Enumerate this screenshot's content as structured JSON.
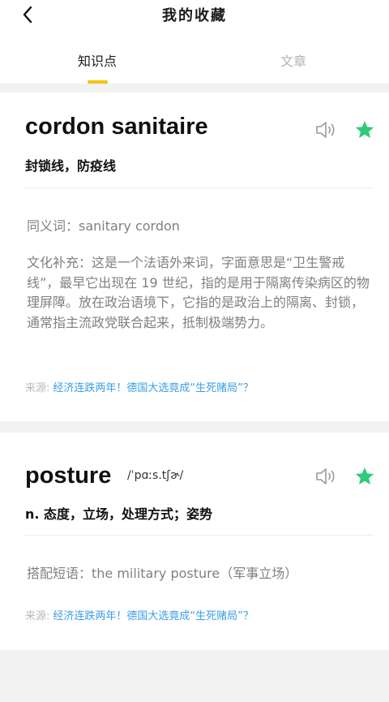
{
  "header": {
    "title": "我的收藏",
    "tabs": [
      {
        "label": "知识点",
        "active": true
      },
      {
        "label": "文章",
        "active": false
      }
    ]
  },
  "cards": [
    {
      "word": "cordon sanitaire",
      "meaning": "封锁线，防疫线",
      "synonym": "同义词：sanitary cordon",
      "culture": "文化补充：这是一个法语外来词，字面意思是“卫生警戒线”，最早它出现在 19 世纪，指的是用于隔离传染病区的物理屏障。放在政治语境下，它指的是政治上的隔离、封锁，通常指主流政党联合起来，抵制极端势力。",
      "source_label": "来源:",
      "source_link": "经济连跌两年！德国大选竟成“生死赌局”？",
      "starred": true
    },
    {
      "word": "posture",
      "phonetic": "/ˈpɑːs.tʃɚ/",
      "meaning": "n. 态度，立场，处理方式；姿势",
      "collocation": "搭配短语：the military posture（军事立场）",
      "source_label": "来源:",
      "source_link": "经济连跌两年！德国大选竟成“生死赌局”？",
      "starred": true
    }
  ],
  "colors": {
    "accent": "#f5c400",
    "star": "#2ecb7a",
    "link": "#3a9ee6",
    "muted": "#808080"
  },
  "icons": [
    "back-arrow-icon",
    "speaker-icon",
    "star-icon"
  ]
}
